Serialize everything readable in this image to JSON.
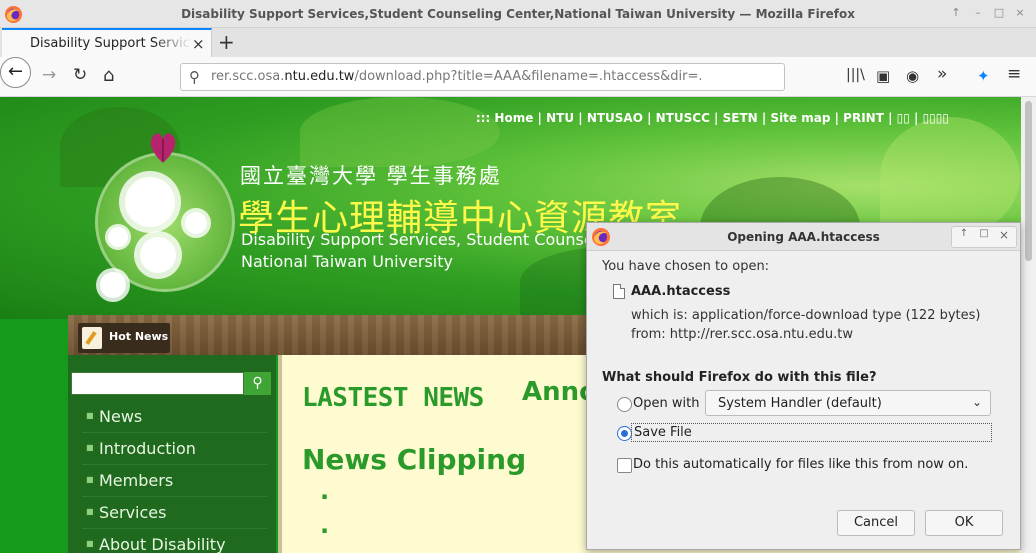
{
  "window": {
    "title": "Disability Support Services,Student Counseling Center,National Taiwan University — Mozilla Firefox",
    "controls": [
      "↑",
      "–",
      "□",
      "×"
    ]
  },
  "tabs": [
    {
      "label": "Disability Support Services,Student Counseling Center,National Taiwan University",
      "close": "×"
    }
  ],
  "newtab_label": "+",
  "navbar": {
    "back": "←",
    "forward": "→",
    "reload": "↻",
    "home": "⌂",
    "url_prefix": "rer.scc.osa.",
    "url_domain": "ntu.edu.tw",
    "url_suffix": "/download.php?title=AAA&filename=.htaccess&dir=.",
    "library": "|||\\",
    "sidebar": "▣",
    "account": "◉",
    "overflow": "»",
    "extensions": "✦",
    "menu": "≡"
  },
  "page": {
    "toplinks": "::: Home | NTU | NTUSAO | NTUSCC | SETN | Site map | PRINT | ▯▯ | ▯▯▯▯",
    "site_sub_zh": "國立臺灣大學 學生事務處",
    "site_title_zh": "學生心理輔導中心資源教室",
    "site_title_en1": "Disability Support Services, Student Counseling Center",
    "site_title_en2": "National Taiwan University",
    "hotnews": "Hot News",
    "search_button": "🔍",
    "menu": [
      "News",
      "Introduction",
      "Members",
      "Services",
      "About Disability"
    ],
    "lastest_news": "LASTEST NEWS",
    "announcement": "Anno",
    "news_clipping": "News Clipping",
    "bullets": [
      "·",
      "·"
    ]
  },
  "dialog": {
    "title": "Opening AAA.htaccess",
    "controls": [
      "↑",
      "□",
      "×"
    ],
    "chosen_text": "You have chosen to open:",
    "filename": "AAA.htaccess",
    "which_is": "which is: application/force-download type (122 bytes)",
    "from": "from: http://rer.scc.osa.ntu.edu.tw",
    "question": "What should Firefox do with this file?",
    "open_with_label": "Open with",
    "open_with_value": "System Handler (default)",
    "open_with_chevron": "⌄",
    "save_file_label": "Save File",
    "auto_label": "Do this automatically for files like this from now on.",
    "cancel": "Cancel",
    "ok": "OK",
    "selected_option": "save_file"
  },
  "colors": {
    "accent": "#0a84ff",
    "site_green": "#2a9a2a",
    "sidebar": "#1f6a1f",
    "content_bg": "#fffbd0",
    "radio_selected": "#2a6edb"
  }
}
